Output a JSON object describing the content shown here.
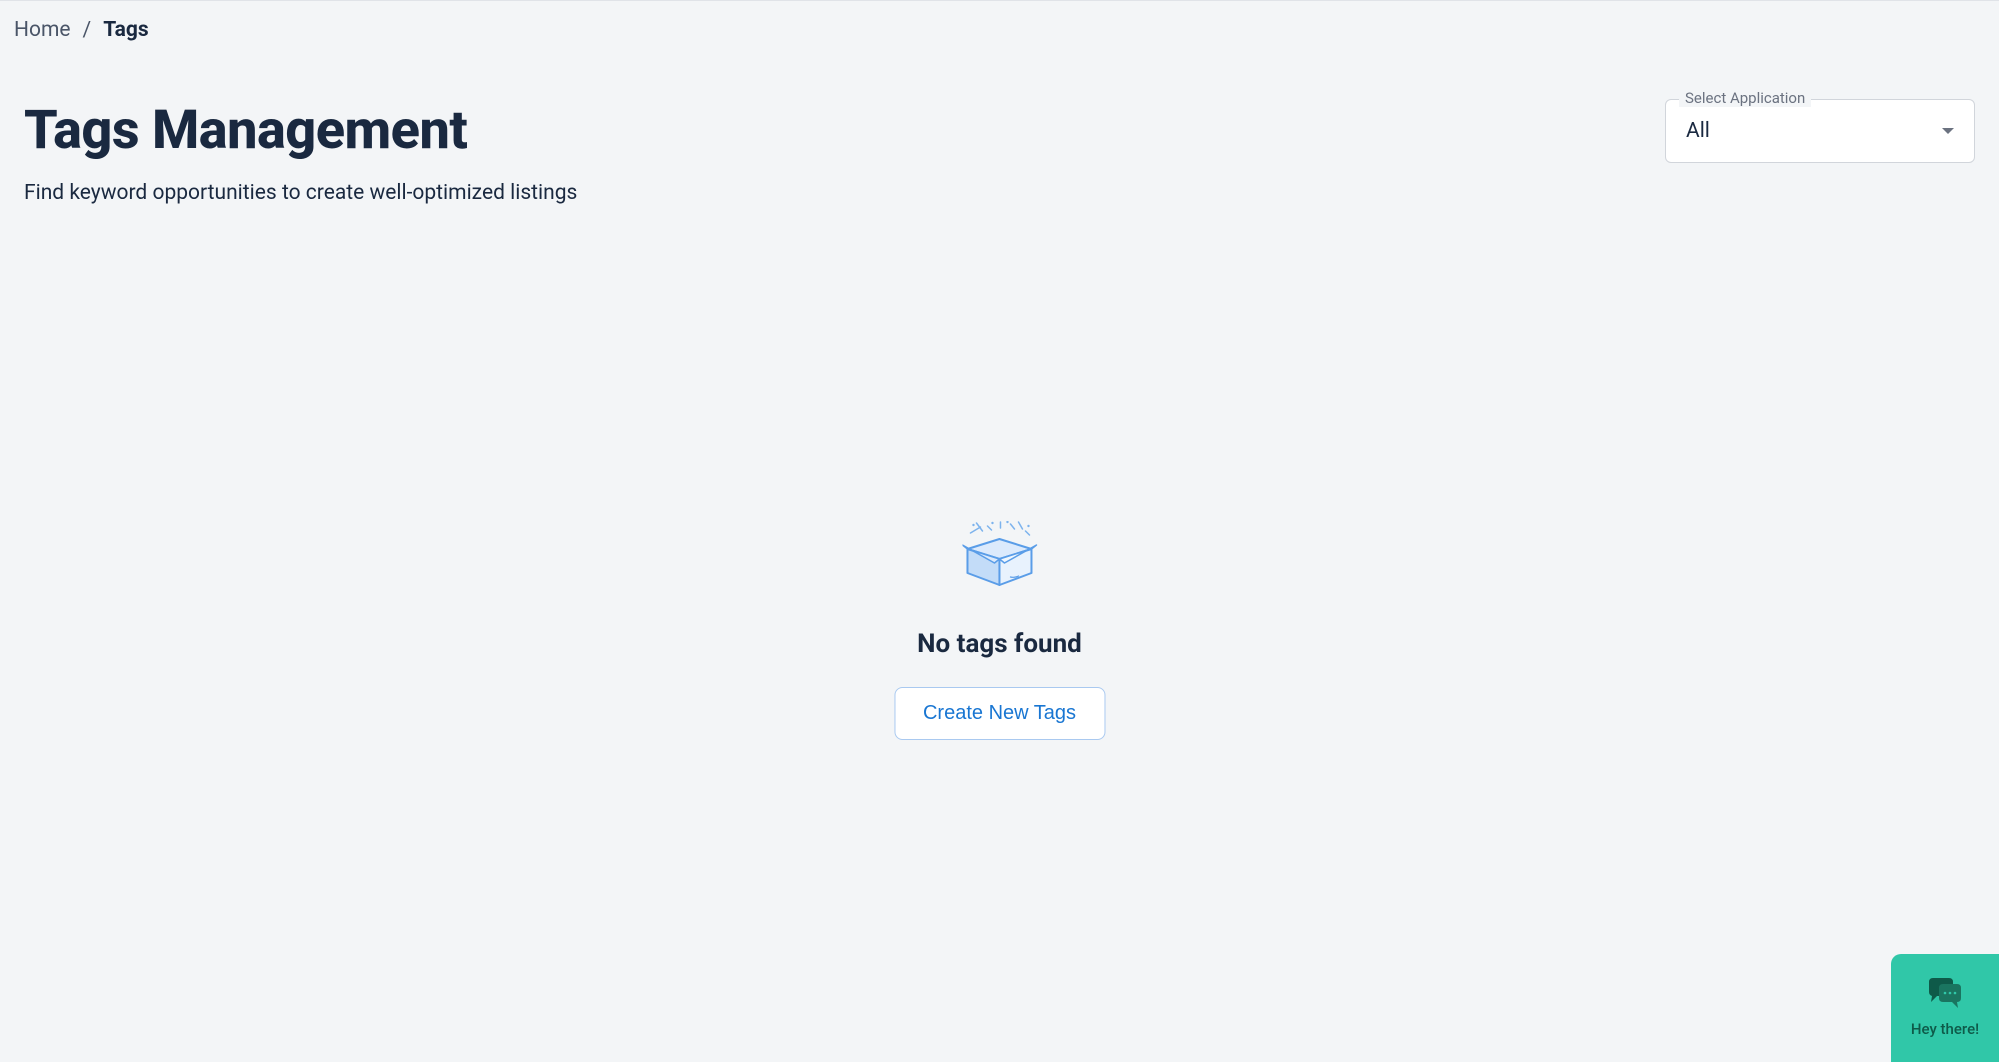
{
  "breadcrumb": {
    "home": "Home",
    "separator": "/",
    "current": "Tags"
  },
  "page": {
    "title": "Tags Management",
    "subtitle": "Find keyword opportunities to create well-optimized listings"
  },
  "select": {
    "label": "Select Application",
    "value": "All"
  },
  "empty_state": {
    "title": "No tags found",
    "button_label": "Create New Tags",
    "icon_name": "empty-box-icon"
  },
  "chat": {
    "label": "Hey there!",
    "icon_name": "chat-bubble-icon"
  }
}
